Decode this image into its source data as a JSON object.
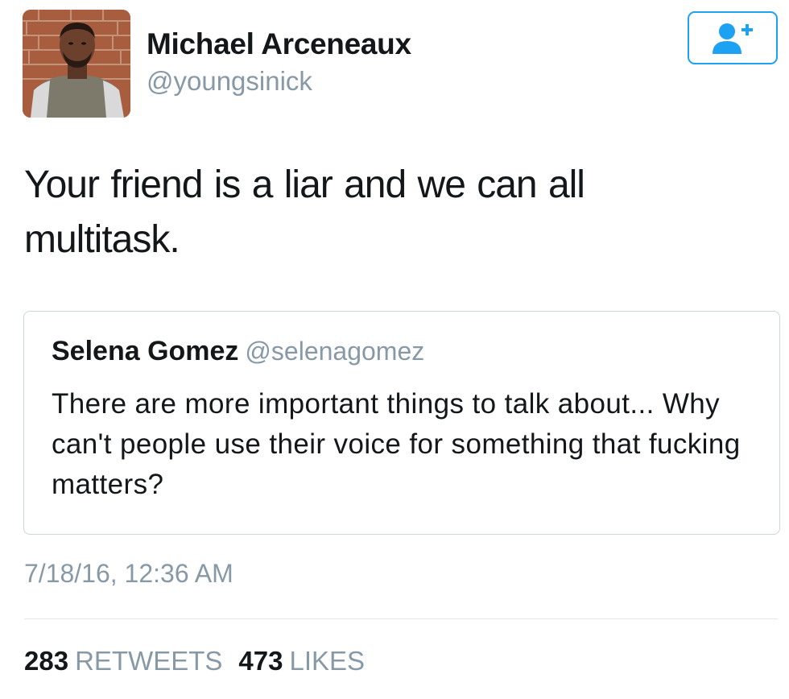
{
  "author": {
    "name": "Michael Arceneaux",
    "handle": "@youngsinick",
    "avatar": "profile-photo"
  },
  "follow_button": {
    "icon": "follow-user-plus-icon",
    "color": "#1da1f2"
  },
  "tweet": {
    "text": "Your friend is a liar and we can all multitask."
  },
  "quoted_tweet": {
    "name": "Selena Gomez",
    "handle": "@selenagomez",
    "text": "There are more important things to talk about... Why can't people use their voice for something that fucking matters?"
  },
  "timestamp": "7/18/16, 12:36 AM",
  "stats": {
    "retweets_count": "283",
    "retweets_label": "RETWEETS",
    "likes_count": "473",
    "likes_label": "LIKES"
  },
  "colors": {
    "accent": "#1da1f2",
    "secondary_text": "#8899a6",
    "primary_text": "#14171a",
    "border": "#ccd6dd"
  }
}
